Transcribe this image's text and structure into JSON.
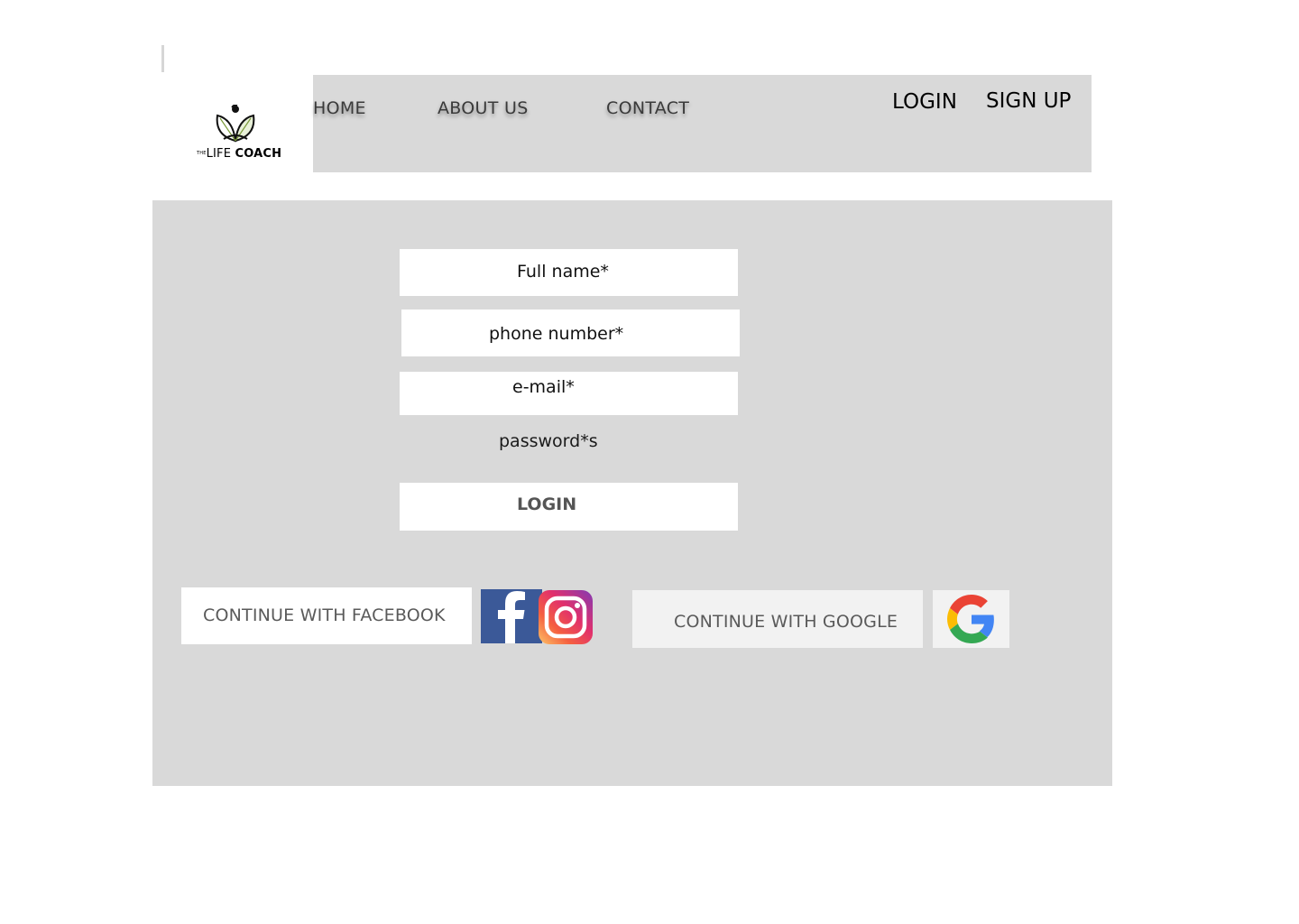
{
  "brand": {
    "prefix": "THE",
    "name_light": "LIFE",
    "name_bold": "COACH"
  },
  "nav": {
    "home": "HOME",
    "about": "ABOUT US",
    "contact": "CONTACT",
    "login": "LOGIN",
    "signup": "SIGN UP"
  },
  "form": {
    "full_name": "Full name*",
    "phone": "phone number*",
    "email": "e-mail*",
    "password": "password*s",
    "submit": "LOGIN"
  },
  "social": {
    "facebook": "CONTINUE WITH FACEBOOK",
    "google": "CONTINUE WITH GOOGLE",
    "facebook_icon": "facebook-icon",
    "instagram_icon": "instagram-icon",
    "google_icon": "google-icon"
  },
  "colors": {
    "panel": "#d9d9d9",
    "facebook": "#3b5998",
    "google_button": "#f2f2f2"
  }
}
